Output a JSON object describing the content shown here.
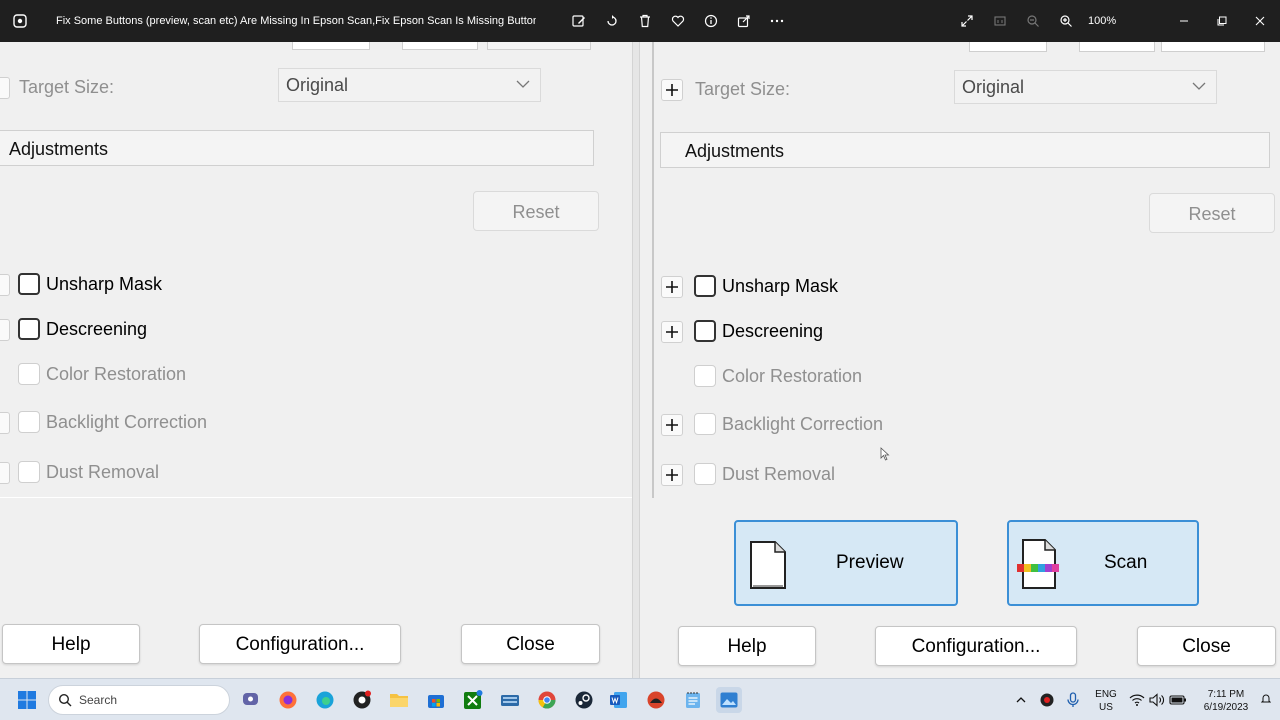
{
  "titlebar": {
    "title": "Fix Some Buttons (preview, scan etc) Are Missing In Epson Scan,Fix Epson Scan Is Missing Button...",
    "zoom": "100%"
  },
  "left_pane": {
    "target_size_label": "Target Size:",
    "target_size_value": "Original",
    "adjustments_label": "Adjustments",
    "reset_label": "Reset",
    "options": [
      {
        "label": "Unsharp Mask",
        "enabled": true
      },
      {
        "label": "Descreening",
        "enabled": true
      },
      {
        "label": "Color Restoration",
        "enabled": false
      },
      {
        "label": "Backlight Correction",
        "enabled": false
      },
      {
        "label": "Dust Removal",
        "enabled": false
      }
    ],
    "help_label": "Help",
    "configuration_label": "Configuration...",
    "close_label": "Close"
  },
  "right_pane": {
    "target_size_label": "Target Size:",
    "target_size_value": "Original",
    "adjustments_label": "Adjustments",
    "reset_label": "Reset",
    "options": [
      {
        "label": "Unsharp Mask",
        "enabled": true
      },
      {
        "label": "Descreening",
        "enabled": true
      },
      {
        "label": "Color Restoration",
        "enabled": false
      },
      {
        "label": "Backlight Correction",
        "enabled": false
      },
      {
        "label": "Dust Removal",
        "enabled": false
      }
    ],
    "preview_label": "Preview",
    "scan_label": "Scan",
    "help_label": "Help",
    "configuration_label": "Configuration...",
    "close_label": "Close"
  },
  "taskbar": {
    "search_placeholder": "Search",
    "language": "ENG",
    "region": "US",
    "time": "7:11 PM",
    "date": "6/19/2023"
  },
  "colors": {
    "accent_blue": "#3b8fd6",
    "big_button_fill": "#d6e8f5",
    "titlebar": "#1f1f1f"
  }
}
